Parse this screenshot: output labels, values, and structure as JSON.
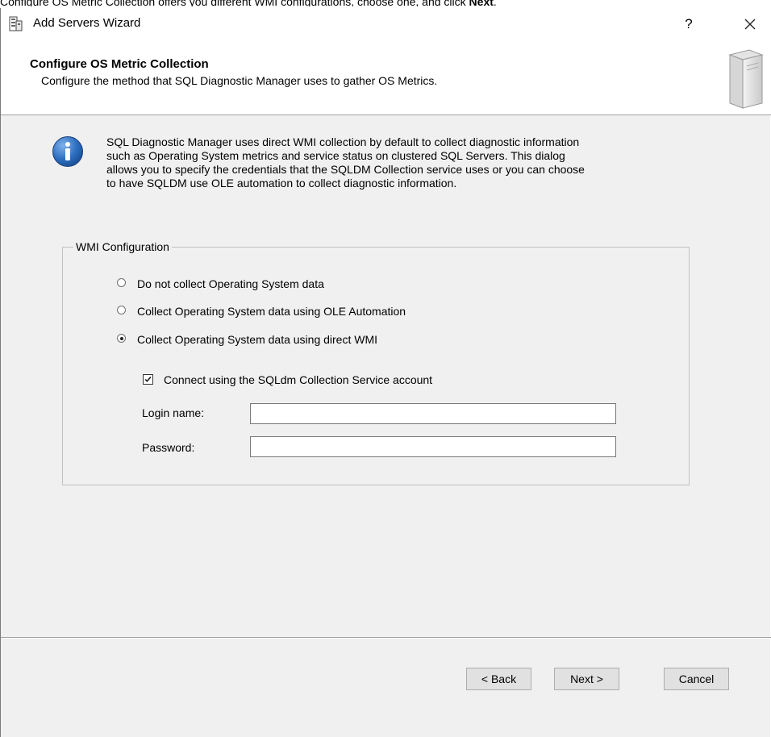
{
  "caption": {
    "before": "Configure OS Metric Collection offers you different WMI configurations, choose one, and click ",
    "bold": "Next",
    "after": "."
  },
  "titlebar": {
    "title": "Add Servers Wizard",
    "help": "?",
    "icon": "wizard-app-icon",
    "close_icon": "close-icon"
  },
  "header": {
    "title": "Configure OS Metric Collection",
    "subtitle": "Configure the method that SQL Diagnostic Manager uses to gather OS Metrics.",
    "icon": "server-tower-icon"
  },
  "info": {
    "icon": "info-icon",
    "lines": [
      "SQL Diagnostic Manager uses direct WMI collection by default to collect diagnostic information",
      "such as Operating System metrics and service status on clustered SQL Servers. This dialog",
      "allows you to specify the credentials that the SQLDM Collection service uses or you can choose",
      "to have SQLDM use OLE automation to collect diagnostic information."
    ]
  },
  "wmi": {
    "legend": "WMI Configuration",
    "options": [
      {
        "label": "Do not collect Operating System data",
        "selected": false
      },
      {
        "label": "Collect Operating System data using OLE Automation",
        "selected": false
      },
      {
        "label": "Collect Operating System data using direct WMI",
        "selected": true
      }
    ],
    "service_account": {
      "label": "Connect using the SQLdm Collection Service account",
      "checked": true
    },
    "login_label": "Login name:",
    "login_value": "",
    "password_label": "Password:",
    "password_value": ""
  },
  "buttons": {
    "back": "< Back",
    "next": "Next >",
    "cancel": "Cancel"
  },
  "colors": {
    "window_bg": "#f0f0f0",
    "info_blue": "#1f5fae",
    "button_bg": "#e1e1e1"
  }
}
